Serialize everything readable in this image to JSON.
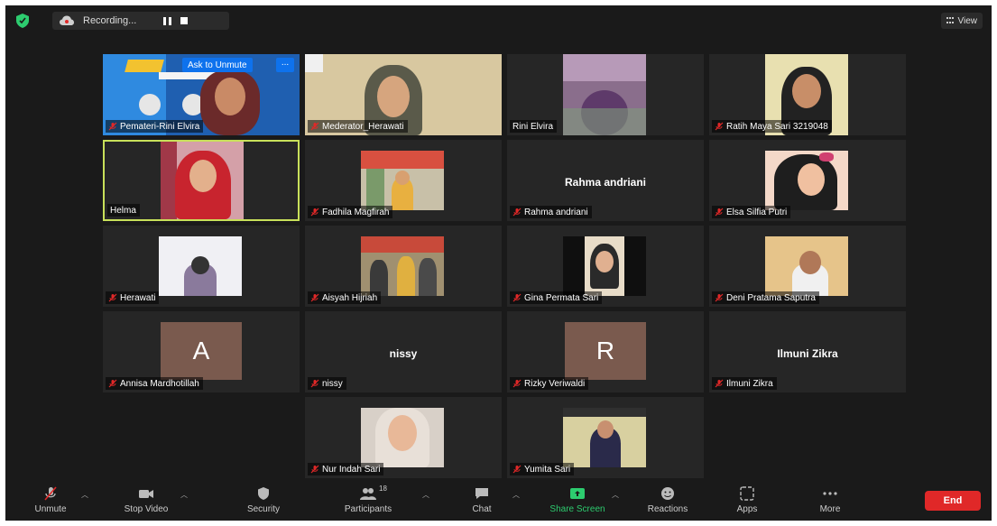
{
  "topbar": {
    "recording_label": "Recording...",
    "view_label": "View"
  },
  "pinned_tile": {
    "ask_to_unmute_label": "Ask to Unmute",
    "more_label": "..."
  },
  "participants": [
    {
      "name": "Pemateri-Rini Elvira"
    },
    {
      "name": "Mederator_Herawati"
    },
    {
      "name": "Rini Elvira"
    },
    {
      "name": "Ratih Maya Sari 3219048"
    },
    {
      "name": "Helma"
    },
    {
      "name": "Fadhila Magfirah"
    },
    {
      "name": "Rahma andriani",
      "center_label": "Rahma andriani"
    },
    {
      "name": "Elsa Silfia Putri"
    },
    {
      "name": "Herawati"
    },
    {
      "name": "Aisyah Hijriah"
    },
    {
      "name": "Gina Permata Sari"
    },
    {
      "name": "Deni Pratama Saputra"
    },
    {
      "name": "Annisa Mardhotillah",
      "avatar_letter": "A"
    },
    {
      "name": "nissy",
      "center_label": "nissy"
    },
    {
      "name": "Rizky Veriwaldi",
      "avatar_letter": "R"
    },
    {
      "name": "Ilmuni Zikra",
      "center_label": "Ilmuni Zikra"
    },
    {
      "name": "Nur Indah Sari"
    },
    {
      "name": "Yumita Sari"
    }
  ],
  "toolbar": {
    "unmute": "Unmute",
    "stop_video": "Stop Video",
    "security": "Security",
    "participants": "Participants",
    "participants_count": "18",
    "chat": "Chat",
    "share_screen": "Share Screen",
    "reactions": "Reactions",
    "apps": "Apps",
    "more": "More",
    "end": "End"
  },
  "colors": {
    "active_speaker_border": "#c8e05a",
    "share_green": "#2dcc6f",
    "end_red": "#e02828",
    "ask_unmute_blue": "#0e72ed",
    "background": "#1a1a1a"
  }
}
